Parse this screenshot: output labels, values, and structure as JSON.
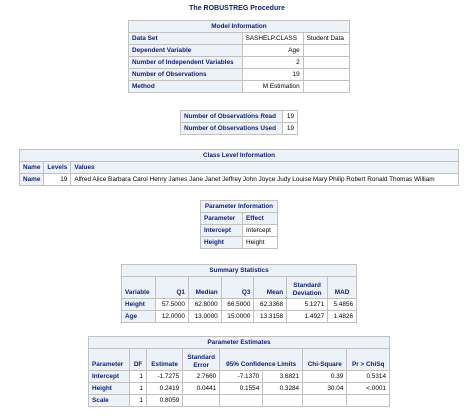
{
  "procedure_title": "The ROBUSTREG Procedure",
  "model_info": {
    "caption": "Model Information",
    "rows": [
      {
        "label": "Data Set",
        "value": "SASHELP.CLASS",
        "extra": "Student Data"
      },
      {
        "label": "Dependent Variable",
        "value": "Age",
        "extra": ""
      },
      {
        "label": "Number of Independent Variables",
        "value": "2",
        "extra": ""
      },
      {
        "label": "Number of Observations",
        "value": "19",
        "extra": ""
      },
      {
        "label": "Method",
        "value": "M Estimation",
        "extra": ""
      }
    ]
  },
  "obs_counts": {
    "rows": [
      {
        "label": "Number of Observations Read",
        "value": "19"
      },
      {
        "label": "Number of Observations Used",
        "value": "19"
      }
    ]
  },
  "class_level": {
    "caption": "Class Level Information",
    "headers": [
      "Name",
      "Levels",
      "Values"
    ],
    "rows": [
      {
        "name": "Name",
        "levels": "19",
        "values": "Alfred Alice Barbara Carol Henry James Jane Janet Jeffrey John Joyce Judy Louise Mary Philip Robert Ronald Thomas William"
      }
    ]
  },
  "param_info": {
    "caption": "Parameter Information",
    "headers": [
      "Parameter",
      "Effect"
    ],
    "rows": [
      {
        "parameter": "Intercept",
        "effect": "Intercept"
      },
      {
        "parameter": "Height",
        "effect": "Height"
      }
    ]
  },
  "summary_stats": {
    "caption": "Summary Statistics",
    "headers": [
      "Variable",
      "Q1",
      "Median",
      "Q3",
      "Mean",
      "Standard Deviation",
      "MAD"
    ],
    "rows": [
      {
        "variable": "Height",
        "q1": "57.5000",
        "median": "62.8000",
        "q3": "66.5000",
        "mean": "62.3368",
        "sd": "5.1271",
        "mad": "5.4856"
      },
      {
        "variable": "Age",
        "q1": "12.0000",
        "median": "13.0000",
        "q3": "15.0000",
        "mean": "13.3158",
        "sd": "1.4927",
        "mad": "1.4826"
      }
    ]
  },
  "param_estimates": {
    "caption": "Parameter Estimates",
    "headers": [
      "Parameter",
      "DF",
      "Estimate",
      "Standard Error",
      "95% Confidence Limits",
      "Chi-Square",
      "Pr > ChiSq"
    ],
    "rows": [
      {
        "parameter": "Intercept",
        "df": "1",
        "estimate": "-1.7275",
        "se": "2.7660",
        "lcl": "-7.1370",
        "ucl": "3.6821",
        "chisq": "0.39",
        "p": "0.5314"
      },
      {
        "parameter": "Height",
        "df": "1",
        "estimate": "0.2419",
        "se": "0.0441",
        "lcl": "0.1554",
        "ucl": "0.3284",
        "chisq": "30.04",
        "p": "<.0001"
      },
      {
        "parameter": "Scale",
        "df": "1",
        "estimate": "0.8059",
        "se": "",
        "lcl": "",
        "ucl": "",
        "chisq": "",
        "p": ""
      }
    ]
  }
}
